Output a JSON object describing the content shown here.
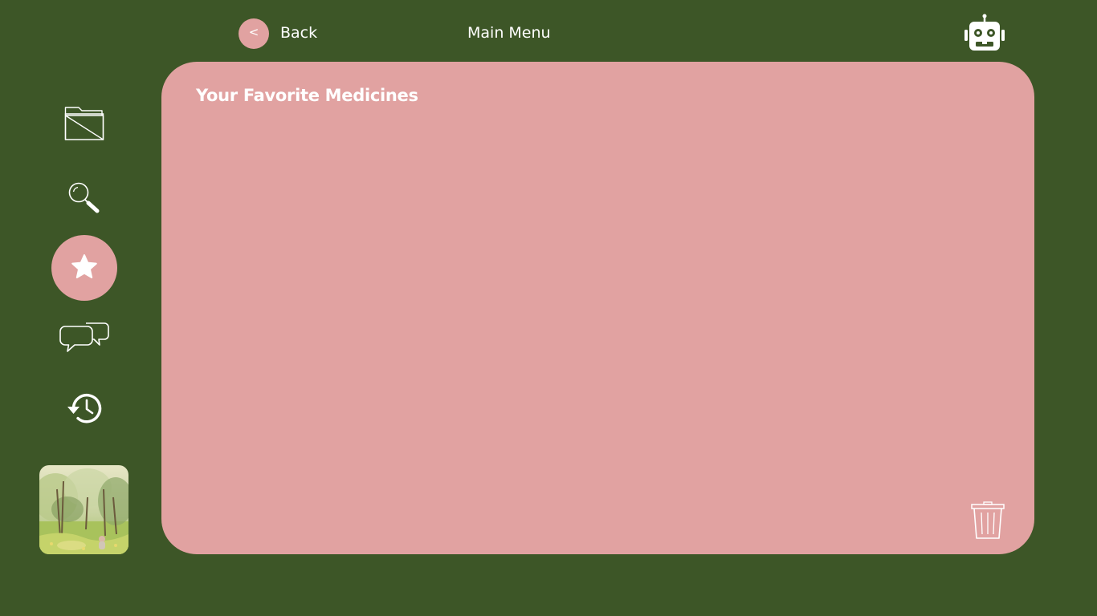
{
  "header": {
    "back_glyph": "<",
    "back_label": "Back",
    "menu_label": "Main Menu",
    "assistant_icon": "robot-icon"
  },
  "sidebar": {
    "items": [
      {
        "icon": "folder-icon",
        "active": false
      },
      {
        "icon": "search-icon",
        "active": false
      },
      {
        "icon": "star-icon",
        "active": true
      },
      {
        "icon": "chat-bubbles-icon",
        "active": false
      },
      {
        "icon": "history-icon",
        "active": false
      }
    ],
    "profile_icon": "avatar"
  },
  "panel": {
    "title": "Your Favorite Medicines",
    "delete_icon": "trash-icon"
  },
  "colors": {
    "background": "#3d5627",
    "accent": "#e1a2a1",
    "foreground": "#ffffff"
  }
}
